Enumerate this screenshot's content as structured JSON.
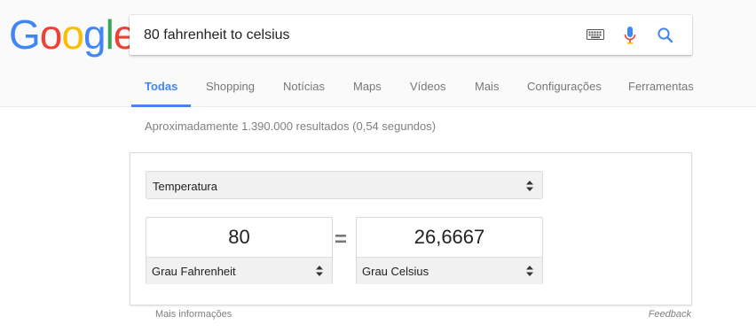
{
  "logo": {
    "letters": [
      {
        "ch": "G",
        "color": "#4285F4"
      },
      {
        "ch": "o",
        "color": "#EA4335"
      },
      {
        "ch": "o",
        "color": "#FBBC05"
      },
      {
        "ch": "g",
        "color": "#4285F4"
      },
      {
        "ch": "l",
        "color": "#34A853"
      },
      {
        "ch": "e",
        "color": "#EA4335"
      }
    ]
  },
  "search": {
    "query": "80 fahrenheit to celsius"
  },
  "tabs": [
    {
      "label": "Todas",
      "active": true
    },
    {
      "label": "Shopping"
    },
    {
      "label": "Notícias"
    },
    {
      "label": "Maps"
    },
    {
      "label": "Vídeos"
    },
    {
      "label": "Mais"
    },
    {
      "label": "Configurações"
    },
    {
      "label": "Ferramentas"
    }
  ],
  "stats": "Aproximadamente 1.390.000 resultados (0,54 segundos)",
  "converter": {
    "category": "Temperatura",
    "from": {
      "value": "80",
      "unit": "Grau Fahrenheit"
    },
    "to": {
      "value": "26,6667",
      "unit": "Grau Celsius"
    },
    "equals": "="
  },
  "footer": {
    "more_info": "Mais informações",
    "feedback": "Feedback"
  },
  "colors": {
    "accent": "#4285F4",
    "mic_blue": "#4285F4",
    "mic_red": "#EA4335"
  }
}
